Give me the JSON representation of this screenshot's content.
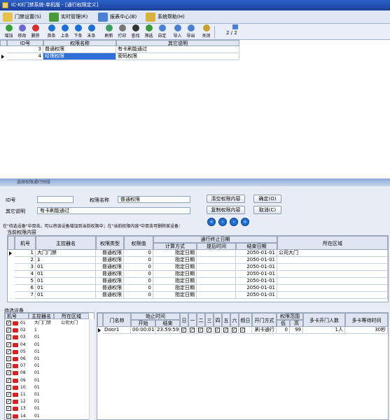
{
  "window": {
    "title": "IC-KE门禁系统-单机版 - [通行权限定义]"
  },
  "menu": [
    {
      "label": "门禁设置(S)",
      "color": "#e4c24a"
    },
    {
      "label": "实时管理(R)",
      "color": "#4a9a3a"
    },
    {
      "label": "报表中心(B)",
      "color": "#4a7fd4"
    },
    {
      "label": "系统帮助(H)",
      "color": "#d8b23a"
    }
  ],
  "toolbar": [
    {
      "label": "增加",
      "icon": "add-icon",
      "color": "#38a038"
    },
    {
      "label": "修改",
      "icon": "edit-icon",
      "color": "#6a6ac8"
    },
    {
      "label": "删除",
      "icon": "delete-icon",
      "color": "#d03030"
    },
    {
      "label": "首条",
      "icon": "first-icon",
      "color": "#1f6fd0"
    },
    {
      "label": "上条",
      "icon": "prev-icon",
      "color": "#1f6fd0"
    },
    {
      "label": "下条",
      "icon": "next-icon",
      "color": "#1f6fd0"
    },
    {
      "label": "末条",
      "icon": "last-icon",
      "color": "#1f6fd0"
    },
    {
      "label": "刷新",
      "icon": "refresh-icon",
      "color": "#3aa060"
    },
    {
      "label": "打印",
      "icon": "print-icon",
      "color": "#777"
    },
    {
      "label": "查找",
      "icon": "find-icon",
      "color": "#333"
    },
    {
      "label": "筛选",
      "icon": "filter-icon",
      "color": "#3a9a3a"
    },
    {
      "label": "自定",
      "icon": "custom-icon",
      "color": "#4a7fd4"
    },
    {
      "label": "导入",
      "icon": "import-icon",
      "color": "#4a7fd4"
    },
    {
      "label": "导出",
      "icon": "export-icon",
      "color": "#4a7fd4"
    },
    {
      "label": "关闭",
      "icon": "close-icon",
      "color": "#c8a030"
    }
  ],
  "page_indicator": "2 / 2",
  "top_grid": {
    "headers": [
      "ID号",
      "权限名称",
      "其它说明"
    ],
    "rows": [
      [
        "3",
        "普通权限",
        "有卡刷能通过"
      ],
      [
        "4",
        "经理权限",
        "密码权限"
      ]
    ]
  },
  "dialog": {
    "title": "选择权限通行时段",
    "id_label": "ID号",
    "id_value": "",
    "name_label": "权限名称",
    "name_value": "普通权限",
    "desc_label": "其它说明",
    "desc_value": "有卡刷能通过",
    "btn_clear": "清空权限内容",
    "btn_ok": "确定(O)",
    "btn_copy": "复制权限内容",
    "btn_cancel": "取消(C)",
    "hint": "在\"待选设备\"中双击，可以将该设备增加到当前权限中；在\"当前权限内容\"中双击可删除某设备：",
    "current_label": "当前权限内容",
    "waiting_label": "待选设备"
  },
  "perm_grid": {
    "headers": {
      "no": "机号",
      "ctrl": "主控器名",
      "type": "权限类型",
      "val": "权限值",
      "end_group": "通行终止日期",
      "calc": "计算方式",
      "adv": "提后时间",
      "end": "结束日期",
      "area": "所在区域"
    },
    "rows": [
      [
        "1",
        "大门门禁",
        "普通权限",
        "0",
        "指定日期",
        "",
        "2050-01-01",
        "公司大门"
      ],
      [
        "2",
        "1",
        "普通权限",
        "0",
        "指定日期",
        "",
        "2050-01-01",
        ""
      ],
      [
        "3",
        "01",
        "普通权限",
        "0",
        "指定日期",
        "",
        "2050-01-01",
        ""
      ],
      [
        "4",
        "01",
        "普通权限",
        "0",
        "指定日期",
        "",
        "2050-01-01",
        ""
      ],
      [
        "5",
        "01",
        "普通权限",
        "0",
        "指定日期",
        "",
        "2050-01-01",
        ""
      ],
      [
        "6",
        "01",
        "普通权限",
        "0",
        "指定日期",
        "",
        "2050-01-01",
        ""
      ],
      [
        "7",
        "01",
        "普通权限",
        "0",
        "指定日期",
        "",
        "2050-01-01",
        ""
      ]
    ]
  },
  "device_list": {
    "headers": [
      "机号",
      "主控器名",
      "所在区域"
    ],
    "rows": [
      [
        "01",
        "大门门禁",
        "公司大门"
      ],
      [
        "02",
        "1",
        ""
      ],
      [
        "03",
        "01",
        ""
      ],
      [
        "04",
        "01",
        ""
      ],
      [
        "05",
        "01",
        ""
      ],
      [
        "06",
        "01",
        ""
      ],
      [
        "07",
        "01",
        ""
      ],
      [
        "08",
        "01",
        ""
      ],
      [
        "09",
        "01",
        ""
      ],
      [
        "10",
        "01",
        ""
      ],
      [
        "11",
        "01",
        ""
      ],
      [
        "12",
        "01",
        ""
      ],
      [
        "13",
        "01",
        ""
      ],
      [
        "14",
        "01",
        ""
      ]
    ]
  },
  "door_grid": {
    "headers": {
      "door": "门名称",
      "time": "始止时间",
      "start": "开始",
      "end": "结束",
      "days": [
        "日",
        "一",
        "二",
        "三",
        "四",
        "五",
        "六",
        "假日"
      ],
      "mode": "开门方式",
      "range": "权限范围",
      "low": "低",
      "high": "高",
      "multi": "多卡开门人数",
      "wait": "多卡等待时间"
    },
    "rows": [
      {
        "door": "Door1",
        "start": "00:00:01",
        "end": "23:59:59",
        "mode": "刷卡通行",
        "low": "0",
        "high": "99",
        "multi": "1人",
        "wait": "30秒"
      }
    ]
  }
}
